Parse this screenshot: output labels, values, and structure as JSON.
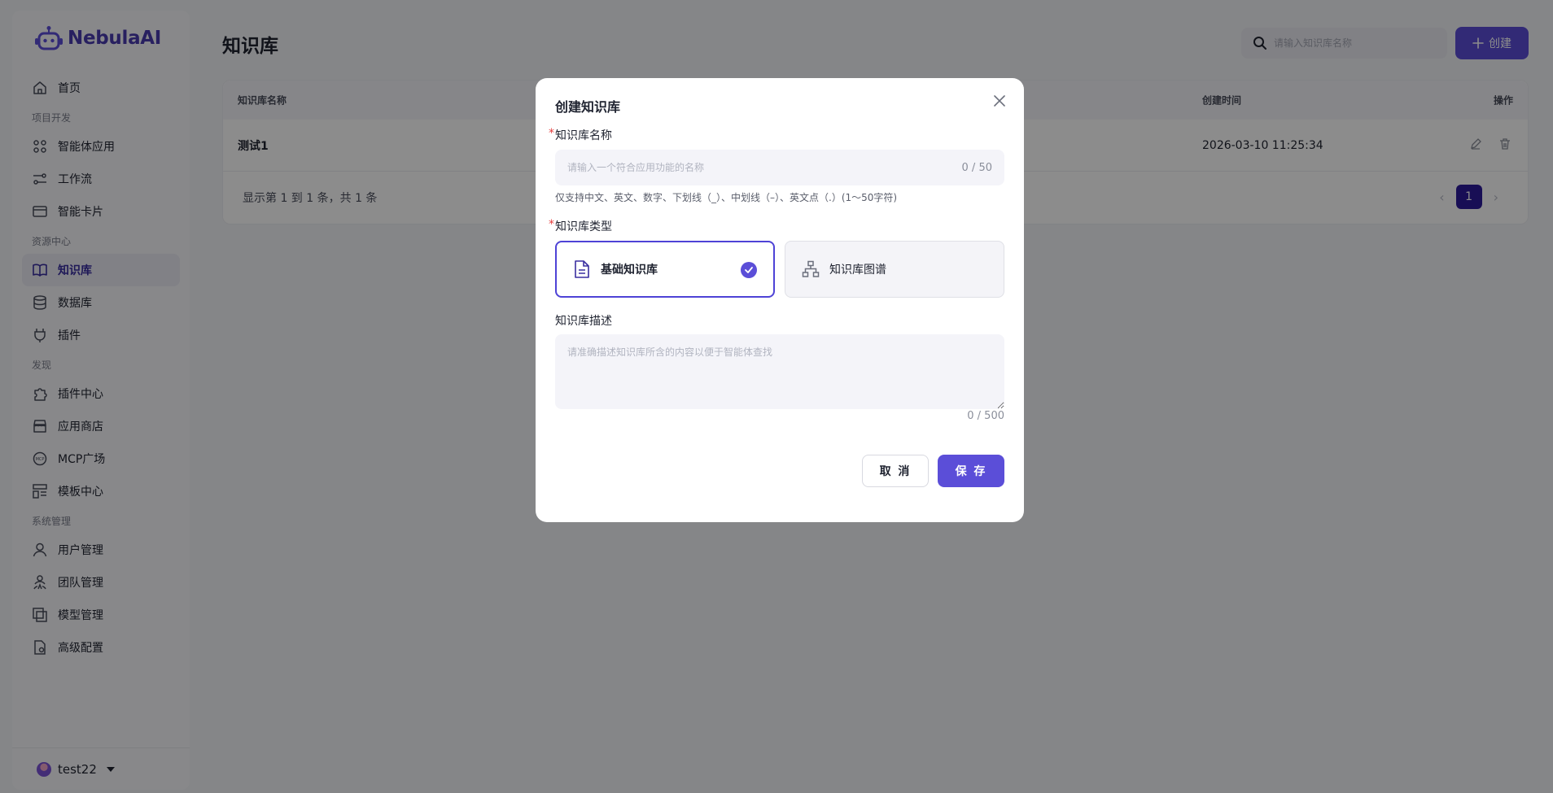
{
  "brand": {
    "name": "NebulaAI"
  },
  "sidebar": {
    "items": [
      {
        "type": "item",
        "label": "首页",
        "icon": "home-icon"
      },
      {
        "type": "section",
        "label": "项目开发"
      },
      {
        "type": "item",
        "label": "智能体应用",
        "icon": "grid-icon"
      },
      {
        "type": "item",
        "label": "工作流",
        "icon": "workflow-icon"
      },
      {
        "type": "item",
        "label": "智能卡片",
        "icon": "card-icon"
      },
      {
        "type": "section",
        "label": "资源中心"
      },
      {
        "type": "item",
        "label": "知识库",
        "icon": "book-icon",
        "active": true
      },
      {
        "type": "item",
        "label": "数据库",
        "icon": "database-icon"
      },
      {
        "type": "item",
        "label": "插件",
        "icon": "plug-icon"
      },
      {
        "type": "section",
        "label": "发现"
      },
      {
        "type": "item",
        "label": "插件中心",
        "icon": "puzzle-icon"
      },
      {
        "type": "item",
        "label": "应用商店",
        "icon": "store-icon"
      },
      {
        "type": "item",
        "label": "MCP广场",
        "icon": "mcp-icon"
      },
      {
        "type": "item",
        "label": "模板中心",
        "icon": "template-icon"
      },
      {
        "type": "section",
        "label": "系统管理"
      },
      {
        "type": "item",
        "label": "用户管理",
        "icon": "user-icon"
      },
      {
        "type": "item",
        "label": "团队管理",
        "icon": "team-icon"
      },
      {
        "type": "item",
        "label": "模型管理",
        "icon": "model-icon"
      },
      {
        "type": "item",
        "label": "高级配置",
        "icon": "config-icon"
      }
    ],
    "user": {
      "name": "test22"
    }
  },
  "header": {
    "title": "知识库",
    "search_placeholder": "请输入知识库名称",
    "create_label": "创建"
  },
  "table": {
    "columns": [
      "知识库名称",
      "创建时间",
      "操作"
    ],
    "rows": [
      {
        "name": "测试1",
        "created": "2026-03-10 11:25:34"
      }
    ],
    "footer": "显示第 1 到 1 条，共 1 条",
    "page": "1"
  },
  "modal": {
    "title": "创建知识库",
    "name_label": "知识库名称",
    "name_placeholder": "请输入一个符合应用功能的名称",
    "name_counter": "0 / 50",
    "name_hint": "仅支持中文、英文、数字、下划线（_）、中划线（–）、英文点（.）(1～50字符)",
    "type_label": "知识库类型",
    "types": [
      {
        "label": "基础知识库",
        "selected": true
      },
      {
        "label": "知识库图谱",
        "selected": false
      }
    ],
    "desc_label": "知识库描述",
    "desc_placeholder": "请准确描述知识库所含的内容以便于智能体查找",
    "desc_counter": "0 / 500",
    "cancel_label": "取 消",
    "save_label": "保 存"
  },
  "colors": {
    "accent": "#5b4ed8",
    "active_nav": "#3a2fa0"
  }
}
